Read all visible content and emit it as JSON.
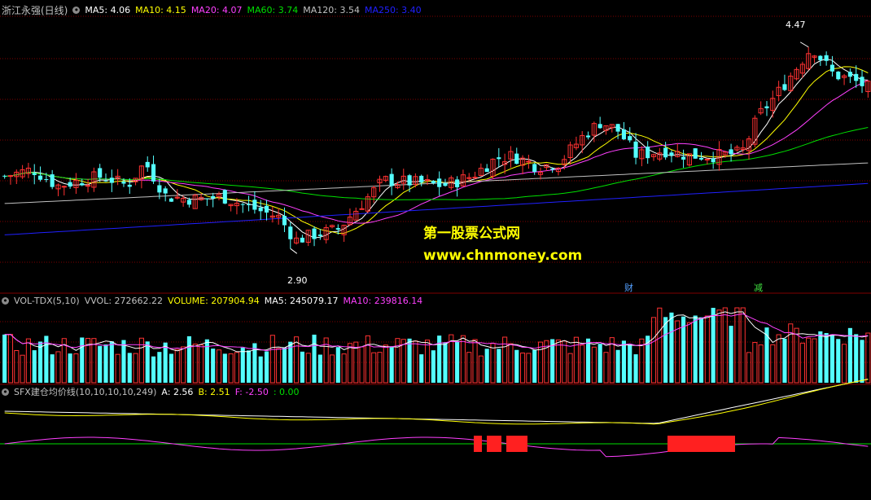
{
  "stock": {
    "name": "浙江永强(日线)"
  },
  "price_legend": [
    {
      "label": "MA5: 4.06",
      "color": "#ffffff"
    },
    {
      "label": "MA10: 4.15",
      "color": "#ffff00"
    },
    {
      "label": "MA20: 4.07",
      "color": "#ff40ff"
    },
    {
      "label": "MA60: 3.74",
      "color": "#00e000"
    },
    {
      "label": "MA120: 3.54",
      "color": "#c0c0c0"
    },
    {
      "label": "MA250: 3.40",
      "color": "#2020ff"
    }
  ],
  "vol_legend": [
    {
      "label": "VOL-TDX(5,10)",
      "color": "#c0c0c0"
    },
    {
      "label": "VVOL: 272662.22",
      "color": "#c0c0c0"
    },
    {
      "label": "VOLUME: 207904.94",
      "color": "#ffff00"
    },
    {
      "label": "MA5: 245079.17",
      "color": "#ffffff"
    },
    {
      "label": "MA10: 239816.14",
      "color": "#ff40ff"
    }
  ],
  "ind_legend": [
    {
      "label": "SFX建仓均价线(10,10,10,10,249)",
      "color": "#c0c0c0"
    },
    {
      "label": "A: 2.56",
      "color": "#ffffff"
    },
    {
      "label": "B: 2.51",
      "color": "#ffff00"
    },
    {
      "label": "F: -2.50",
      "color": "#ff40ff"
    },
    {
      "label": ": 0.00",
      "color": "#00e000"
    }
  ],
  "annotations": {
    "high_label": "4.47",
    "low_label": "2.90",
    "tag_cai": "财",
    "tag_jian": "减"
  },
  "watermark": {
    "line1": "第一股票公式网",
    "line2": "www.chnmoney.com"
  },
  "colors": {
    "up": "#ff3232",
    "down": "#54ffff",
    "grid": "#800000"
  },
  "chart_data": {
    "type": "candlestick",
    "bars": 146,
    "price_range": [
      2.7,
      4.6
    ],
    "high": 4.47,
    "low": 2.9,
    "price_anchors": [
      [
        0,
        3.45
      ],
      [
        8,
        3.5
      ],
      [
        15,
        3.38
      ],
      [
        22,
        3.42
      ],
      [
        28,
        3.45
      ],
      [
        35,
        3.38
      ],
      [
        40,
        3.55
      ],
      [
        46,
        3.3
      ],
      [
        55,
        3.28
      ],
      [
        62,
        3.3
      ],
      [
        70,
        3.22
      ],
      [
        78,
        3.15
      ],
      [
        83,
        2.98
      ],
      [
        88,
        3.02
      ],
      [
        95,
        3.06
      ],
      [
        100,
        3.2
      ],
      [
        108,
        3.42
      ],
      [
        118,
        3.4
      ],
      [
        125,
        3.38
      ],
      [
        133,
        3.45
      ],
      [
        140,
        3.58
      ],
      [
        145,
        3.6
      ],
      [
        152,
        3.52
      ],
      [
        158,
        3.55
      ],
      [
        165,
        3.75
      ],
      [
        170,
        3.85
      ],
      [
        175,
        3.78
      ],
      [
        180,
        3.6
      ],
      [
        188,
        3.64
      ],
      [
        195,
        3.6
      ],
      [
        203,
        3.6
      ],
      [
        210,
        3.62
      ],
      [
        215,
        3.9
      ],
      [
        220,
        4.05
      ],
      [
        230,
        4.4
      ],
      [
        236,
        4.2
      ],
      [
        242,
        4.15
      ],
      [
        246,
        4.1
      ]
    ],
    "ma_last": {
      "MA5": 4.06,
      "MA10": 4.15,
      "MA20": 4.07,
      "MA60": 3.74,
      "MA120": 3.54,
      "MA250": 3.4
    },
    "volume_last": {
      "VVOL": 272662.22,
      "VOLUME": 207904.94,
      "MA5": 245079.17,
      "MA10": 239816.14
    },
    "indicator_last": {
      "A": 2.56,
      "B": 2.51,
      "F": -2.5,
      "ZERO": 0.0
    }
  }
}
